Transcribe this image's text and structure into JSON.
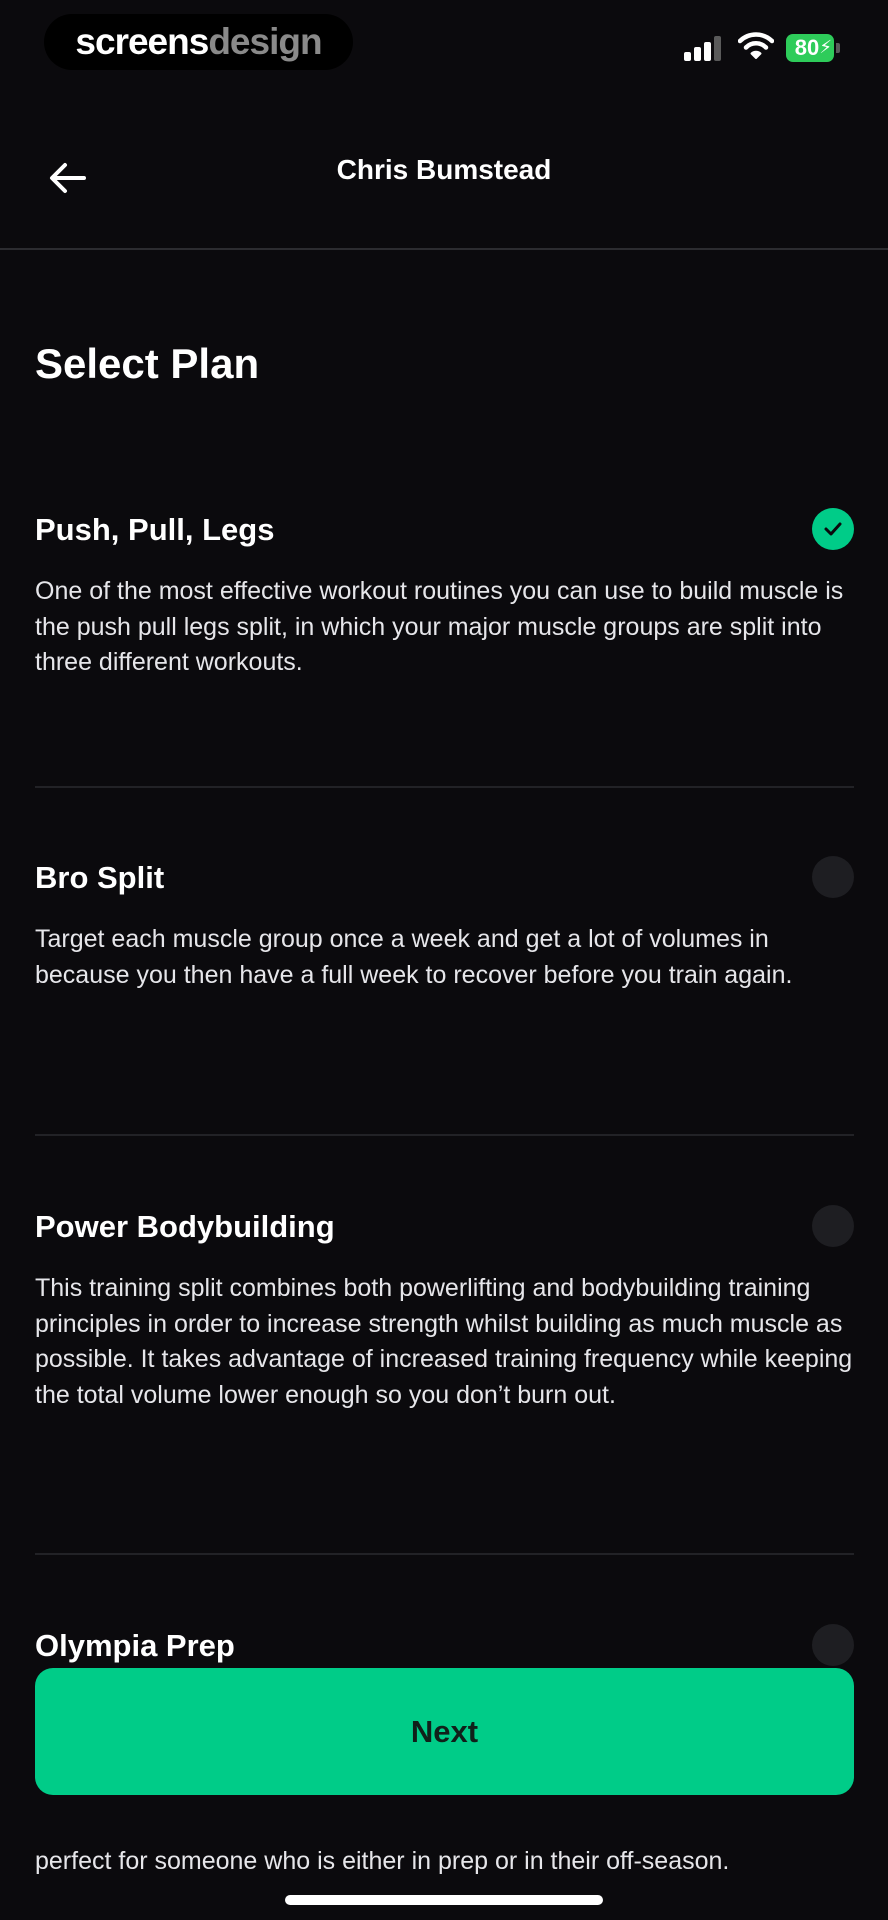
{
  "status_bar": {
    "watermark_part1": "screens",
    "watermark_part2": "design",
    "battery_level": "80",
    "icons": [
      "cellular-signal-icon",
      "wifi-icon",
      "battery-charging-icon"
    ]
  },
  "header": {
    "title": "Chris Bumstead",
    "back_icon": "arrow-left-icon"
  },
  "page": {
    "title": "Select Plan"
  },
  "plans": [
    {
      "name": "Push, Pull, Legs",
      "description": "One of the most effective workout routines you can use to build muscle is the push pull legs split, in which your major muscle groups are split into three different workouts.",
      "selected": true
    },
    {
      "name": "Bro Split",
      "description": "Target each muscle group once a week and get a lot of volumes in because you then have a full week to recover before you train again.",
      "selected": false
    },
    {
      "name": "Power Bodybuilding",
      "description": "This training split combines both powerlifting and bodybuilding training principles in order to increase strength whilst building as much muscle as possible. It takes advantage of increased training frequency while keeping the total volume lower enough so you don’t burn out.",
      "selected": false
    },
    {
      "name": "Olympia Prep",
      "description": "perfect for someone who is either in prep or in their off-season.",
      "selected": false
    }
  ],
  "footer": {
    "next_label": "Next"
  },
  "colors": {
    "background": "#0b0a0d",
    "accent": "#00cc88",
    "text": "#ffffff",
    "divider": "#222226",
    "radio_off": "#1e1e22"
  }
}
